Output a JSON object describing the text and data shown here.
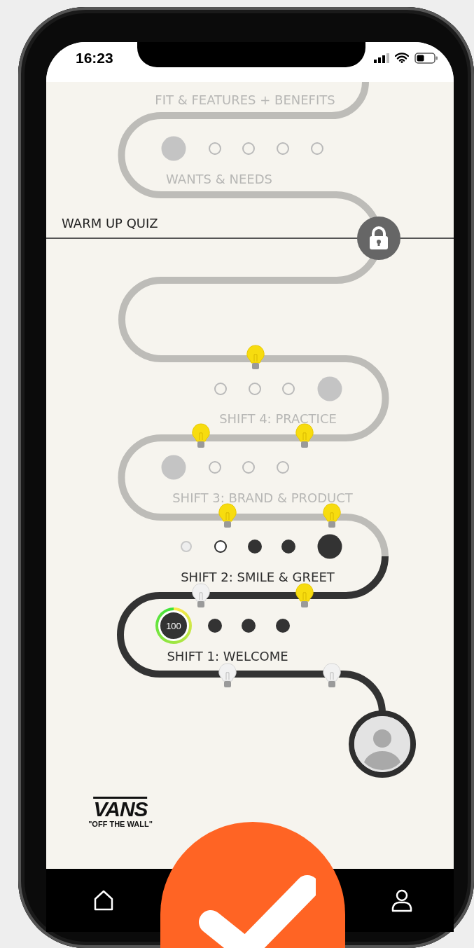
{
  "status_bar": {
    "time": "16:23"
  },
  "levels": [
    {
      "title": "FIT & FEATURES + BENEFITS",
      "unlocked": false
    },
    {
      "title": "WANTS & NEEDS",
      "unlocked": false,
      "steps": [
        {
          "kind": "milestone",
          "completed": false,
          "current": false
        },
        {
          "kind": "step",
          "completed": false,
          "current": false
        },
        {
          "kind": "step",
          "completed": false,
          "current": false
        },
        {
          "kind": "step",
          "completed": false,
          "current": false
        },
        {
          "kind": "step",
          "completed": false,
          "current": false
        }
      ]
    },
    {
      "title": "SHIFT 4: PRACTICE",
      "unlocked": false,
      "steps": [
        {
          "kind": "step",
          "completed": false,
          "current": false
        },
        {
          "kind": "step",
          "completed": false,
          "current": false
        },
        {
          "kind": "step",
          "completed": false,
          "current": false
        },
        {
          "kind": "milestone",
          "completed": false,
          "current": false
        }
      ]
    },
    {
      "title": "SHIFT 3: BRAND & PRODUCT",
      "unlocked": false,
      "steps": [
        {
          "kind": "milestone",
          "completed": false,
          "current": false
        },
        {
          "kind": "step",
          "completed": false,
          "current": false
        },
        {
          "kind": "step",
          "completed": false,
          "current": false
        },
        {
          "kind": "step",
          "completed": false,
          "current": false
        }
      ]
    },
    {
      "title": "SHIFT 2: SMILE & GREET",
      "unlocked": true,
      "steps": [
        {
          "kind": "step",
          "completed": false,
          "current": false
        },
        {
          "kind": "step",
          "completed": false,
          "current": true
        },
        {
          "kind": "step",
          "completed": true,
          "current": false
        },
        {
          "kind": "step",
          "completed": true,
          "current": false
        },
        {
          "kind": "milestone",
          "completed": true,
          "current": false
        }
      ]
    },
    {
      "title": "SHIFT 1: WELCOME",
      "unlocked": true,
      "steps": [
        {
          "kind": "score",
          "label": "100",
          "level": 1
        },
        {
          "kind": "step",
          "completed": true,
          "current": false
        },
        {
          "kind": "step",
          "completed": true,
          "current": false
        },
        {
          "kind": "step",
          "completed": true,
          "current": false
        }
      ]
    }
  ],
  "quiz": {
    "label": "WARM UP QUIZ",
    "locked": true
  },
  "bulbs": [
    {
      "lit": true
    },
    {
      "lit": true
    },
    {
      "lit": true
    },
    {
      "lit": true
    },
    {
      "lit": true
    },
    {
      "lit": false
    },
    {
      "lit": true
    },
    {
      "lit": false
    },
    {
      "lit": false
    }
  ],
  "logo": {
    "brand": "VANS",
    "tagline": "\"OFF THE WALL\""
  },
  "nav": [
    {
      "kind": "home"
    },
    {
      "kind": "check"
    },
    {
      "kind": "profile"
    }
  ]
}
